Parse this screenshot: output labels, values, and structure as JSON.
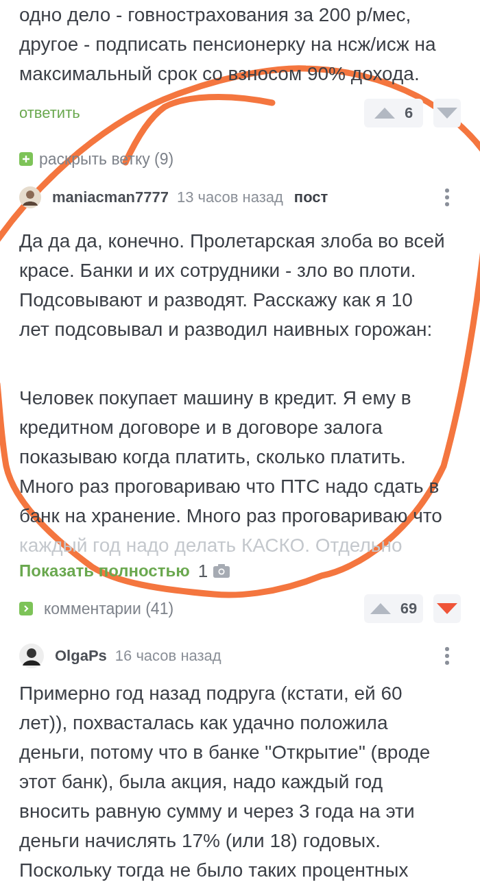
{
  "top_comment": {
    "lines": [
      "одно дело - говнострахования за 200 р/мес,",
      "другое - подписать пенсионерку на нсж/исж на",
      "максимальный срок со взносом 90% дохода."
    ],
    "reply_link": "ответить",
    "upvotes": "6",
    "downvoted": false
  },
  "expand_thread": {
    "label": "раскрыть ветку (9)"
  },
  "post": {
    "author": "maniacman7777",
    "time": "13 часов назад",
    "tag": "пост",
    "paragraphs": [
      [
        "Да да да, конечно. Пролетарская злоба во всей",
        "красе. Банки и их сотрудники - зло во плоти.",
        "Подсовывают и разводят. Расскажу как я 10",
        "лет подсовывал и разводил наивных горожан:"
      ],
      [
        "Человек покупает машину в кредит. Я ему в",
        "кредитном договоре и в договоре залога",
        "показываю когда платить, сколько платить.",
        "Много раз проговариваю что ПТС надо сдать в",
        "банк на хранение. Много раз проговариваю что"
      ]
    ],
    "faded_line": "каждый год надо делать КАСКО. Отдельно",
    "show_more": "Показать полностью",
    "photo_count": "1",
    "comments_link": "комментарии (41)",
    "upvotes": "69",
    "downvoted": true
  },
  "comment": {
    "author": "OlgaPs",
    "time": "16 часов назад",
    "lines": [
      "Примерно год назад подруга (кстати, ей 60",
      "лет)), похвасталась как удачно положила",
      "деньги, потому что в банке \"Открытие\" (вроде",
      "этот банк), была акция, надо каждый год",
      "вносить равную сумму и через 3 года на эти",
      "деньги начислять 17% (или 18) годовых.",
      "Поскольку тогда не было таких процентных"
    ]
  }
}
